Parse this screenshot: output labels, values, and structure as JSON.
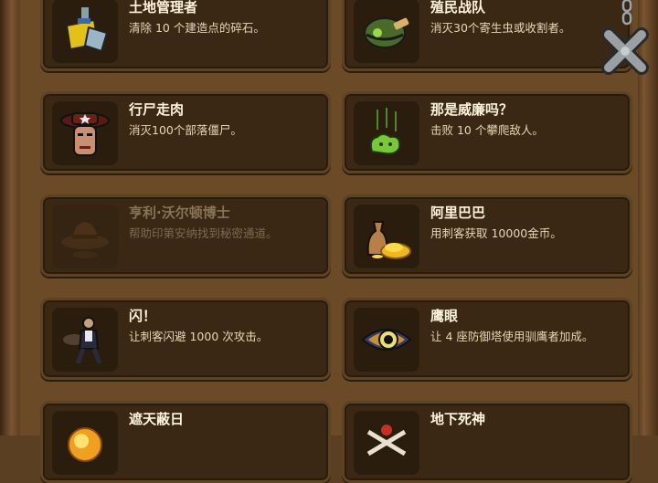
{
  "achievements": [
    {
      "title": "土地管理者",
      "desc": "清除 10 个建造点的碎石。",
      "icon": "shovel-icon",
      "locked": false
    },
    {
      "title": "殖民战队",
      "desc": "消灭30个寄生虫或收割者。",
      "icon": "helmet-icon",
      "locked": false
    },
    {
      "title": "行尸走肉",
      "desc": "消灭100个部落僵尸。",
      "icon": "zombie-head-icon",
      "locked": false
    },
    {
      "title": "那是威廉吗？",
      "desc": "击败 10 个攀爬敌人。",
      "icon": "slime-icon",
      "locked": false
    },
    {
      "title": "亨利·沃尔顿博士",
      "desc": "帮助印第安纳找到秘密通道。",
      "icon": "fedora-hat-icon",
      "locked": true
    },
    {
      "title": "阿里巴巴",
      "desc": "用刺客获取 10000金币。",
      "icon": "gold-sack-icon",
      "locked": false
    },
    {
      "title": "闪！",
      "desc": "让刺客闪避 1000 次攻击。",
      "icon": "assassin-icon",
      "locked": false
    },
    {
      "title": "鹰眼",
      "desc": "让 4 座防御塔使用驯鹰者加成。",
      "icon": "eagle-eye-icon",
      "locked": false
    },
    {
      "title": "遮天蔽日",
      "desc": "",
      "icon": "sun-orb-icon",
      "locked": false
    },
    {
      "title": "地下死神",
      "desc": "",
      "icon": "skull-bones-icon",
      "locked": false
    }
  ],
  "colors": {
    "panel": "#6b4a28",
    "card": "#3a2814",
    "title": "#fff4dc",
    "desc": "#e8d6b4"
  }
}
